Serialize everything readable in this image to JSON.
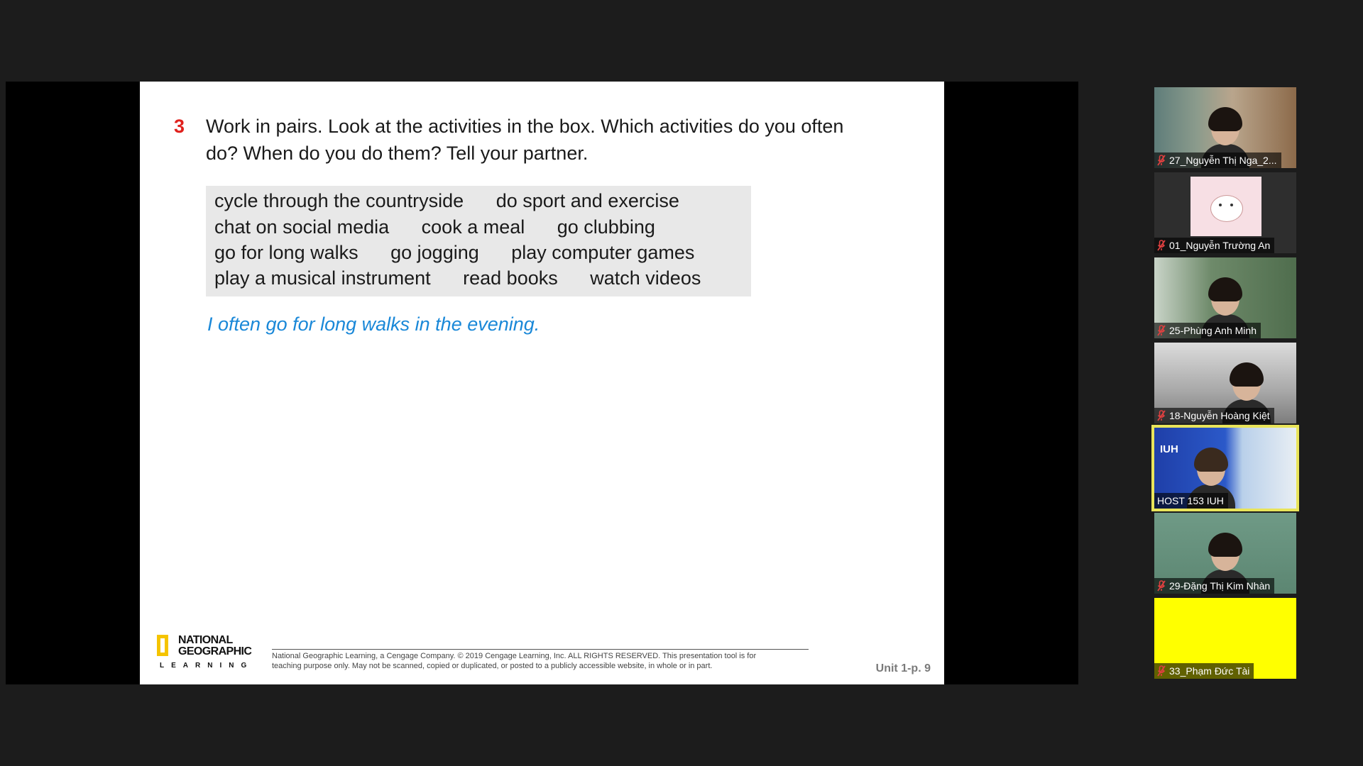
{
  "slide": {
    "question_number": "3",
    "question_line1": "Work in pairs. Look at the activities in the box. Which activities do you often",
    "question_line2": "do? When do you do them? Tell your partner.",
    "activities": [
      [
        "cycle through the countryside",
        "do sport and exercise"
      ],
      [
        "chat on social media",
        "cook a meal",
        "go clubbing"
      ],
      [
        "go for long walks",
        "go jogging",
        "play computer games"
      ],
      [
        "play a musical instrument",
        "read books",
        "watch videos"
      ]
    ],
    "example": "I often go for long walks in the evening.",
    "logo": {
      "line1": "NATIONAL",
      "line2": "GEOGRAPHIC",
      "line3": "LEARNING"
    },
    "copyright_line1": "National Geographic Learning, a Cengage Company. © 2019 Cengage Learning, Inc. ALL RIGHTS RESERVED. This presentation tool is for",
    "copyright_line2": "teaching purpose only. May not be scanned, copied or duplicated, or posted to a publicly accessible website, in whole or in part.",
    "page_ref": "Unit 1-p. 9"
  },
  "participants": [
    {
      "name": "27_Nguyễn Thị Nga_2...",
      "muted": true,
      "video": "camera"
    },
    {
      "name": "01_Nguyễn Trường An",
      "muted": true,
      "video": "avatar"
    },
    {
      "name": "25-Phùng Anh Minh",
      "muted": true,
      "video": "camera"
    },
    {
      "name": "18-Nguyễn Hoàng Kiệt",
      "muted": true,
      "video": "camera"
    },
    {
      "name": "HOST 153 IUH",
      "muted": false,
      "video": "camera",
      "active_speaker": true,
      "background_text": "IUH"
    },
    {
      "name": "29-Đặng Thị Kim Nhàn",
      "muted": true,
      "video": "camera"
    },
    {
      "name": "33_Phạm Đức Tài",
      "muted": true,
      "video": "off"
    }
  ],
  "colors": {
    "question_number": "#e0211d",
    "example_text": "#1a88d8",
    "box_background": "#e8e8e8",
    "active_speaker_border": "#e9e45a",
    "muted_icon": "#e04040",
    "app_background": "#1c1c1c"
  },
  "icons": {
    "muted": "microphone-muted-icon"
  }
}
